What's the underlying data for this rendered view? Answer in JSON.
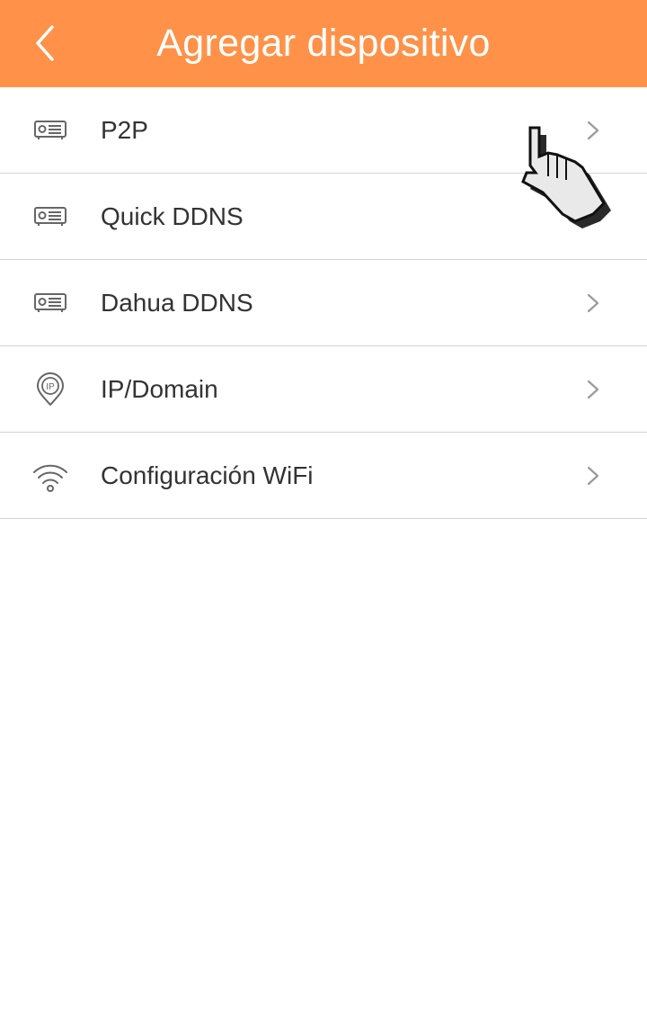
{
  "header": {
    "title": "Agregar dispositivo",
    "back_icon": "chevron-left-icon",
    "background_color": "#ff9248"
  },
  "menu": {
    "items": [
      {
        "label": "P2P",
        "icon": "dvr-device-icon"
      },
      {
        "label": "Quick DDNS",
        "icon": "dvr-device-icon"
      },
      {
        "label": "Dahua DDNS",
        "icon": "dvr-device-icon"
      },
      {
        "label": "IP/Domain",
        "icon": "ip-location-pin-icon"
      },
      {
        "label": "Configuración WiFi",
        "icon": "wifi-icon"
      }
    ],
    "row_arrow_icon": "chevron-right-icon"
  },
  "overlay": {
    "pointer_icon": "hand-pointer-cursor-icon"
  }
}
